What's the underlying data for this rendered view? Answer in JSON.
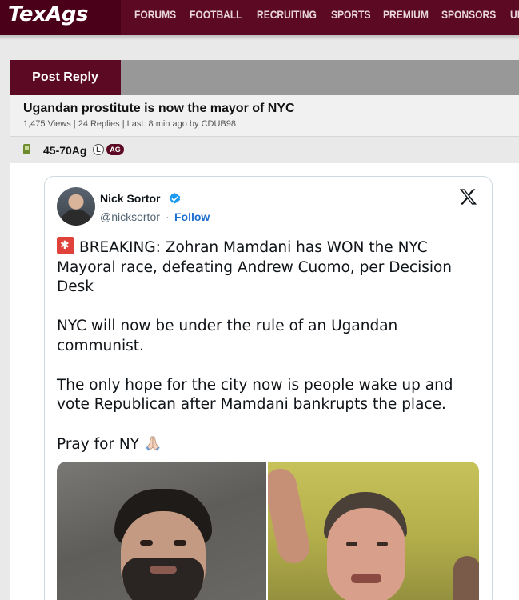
{
  "site": {
    "logo": "TexAgs",
    "nav": [
      "FORUMS",
      "FOOTBALL",
      "RECRUITING",
      "SPORTS",
      "PREMIUM",
      "SPONSORS",
      "UNITED"
    ]
  },
  "reply": {
    "label": "Post Reply"
  },
  "thread": {
    "title": "Ugandan prostitute is now the mayor of NYC",
    "meta": "1,475 Views | 24 Replies | Last: 8 min ago by CDUB98"
  },
  "poster": {
    "name": "45-70Ag",
    "badge_l": "L",
    "badge_ag": "AG"
  },
  "tweet": {
    "author": "Nick Sortor",
    "handle": "@nicksortor",
    "separator": "·",
    "follow": "Follow",
    "para1": "BREAKING: Zohran Mamdani has WON the NYC Mayoral race, defeating Andrew Cuomo, per Decision Desk",
    "para2": "NYC will now be under the rule of an Ugandan communist.",
    "para3": "The only hope for the city now is people wake up and vote Republican after Mamdani bankrupts the place.",
    "para4": "Pray for NY"
  },
  "colors": {
    "brand": "#5c0a24",
    "link": "#1d6fd1",
    "verified": "#1d9bf0"
  },
  "icons": [
    "phone-icon",
    "verified-icon",
    "x-logo-icon",
    "siren-icon",
    "pray-icon"
  ]
}
